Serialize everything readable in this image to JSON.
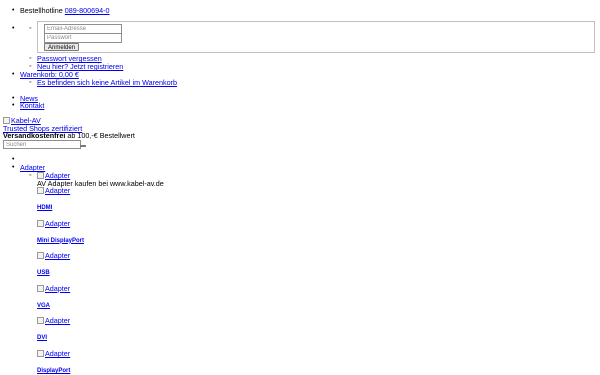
{
  "hotline": {
    "label": "Bestellhotline",
    "number": "089-800694-0"
  },
  "login": {
    "email_placeholder": "Email-Adresse",
    "password_placeholder": "Passwort",
    "submit_label": "Anmelden",
    "forgot_password": "Passwort vergessen",
    "register": "Neu hier? Jetzt registrieren"
  },
  "cart": {
    "label": "Warenkorb: 0,00 €",
    "empty_text": "Es befinden sich keine Artikel im Warenkorb"
  },
  "nav": {
    "news": "News",
    "kontakt": "Kontakt"
  },
  "logo": {
    "alt": "Kabel-AV"
  },
  "trusted": {
    "label": "Trusted Shops zertifiziert"
  },
  "shipping": {
    "bold": "Versandkostenfrei",
    "rest": "ab 100,-€ Bestellwert"
  },
  "search": {
    "placeholder": "Suchen"
  },
  "menu": {
    "adapter_label": "Adapter",
    "adapter_image_alt": "Adapter",
    "adapter_description": "AV Adapter kaufen bei www.kabel-av.de",
    "categories": [
      {
        "alt": "Adapter",
        "label": "HDMI"
      },
      {
        "alt": "Adapter",
        "label": "Mini DisplayPort"
      },
      {
        "alt": "Adapter",
        "label": "USB"
      },
      {
        "alt": "Adapter",
        "label": "VGA"
      },
      {
        "alt": "Adapter",
        "label": "DVI"
      },
      {
        "alt": "Adapter",
        "label": "DisplayPort"
      }
    ]
  }
}
